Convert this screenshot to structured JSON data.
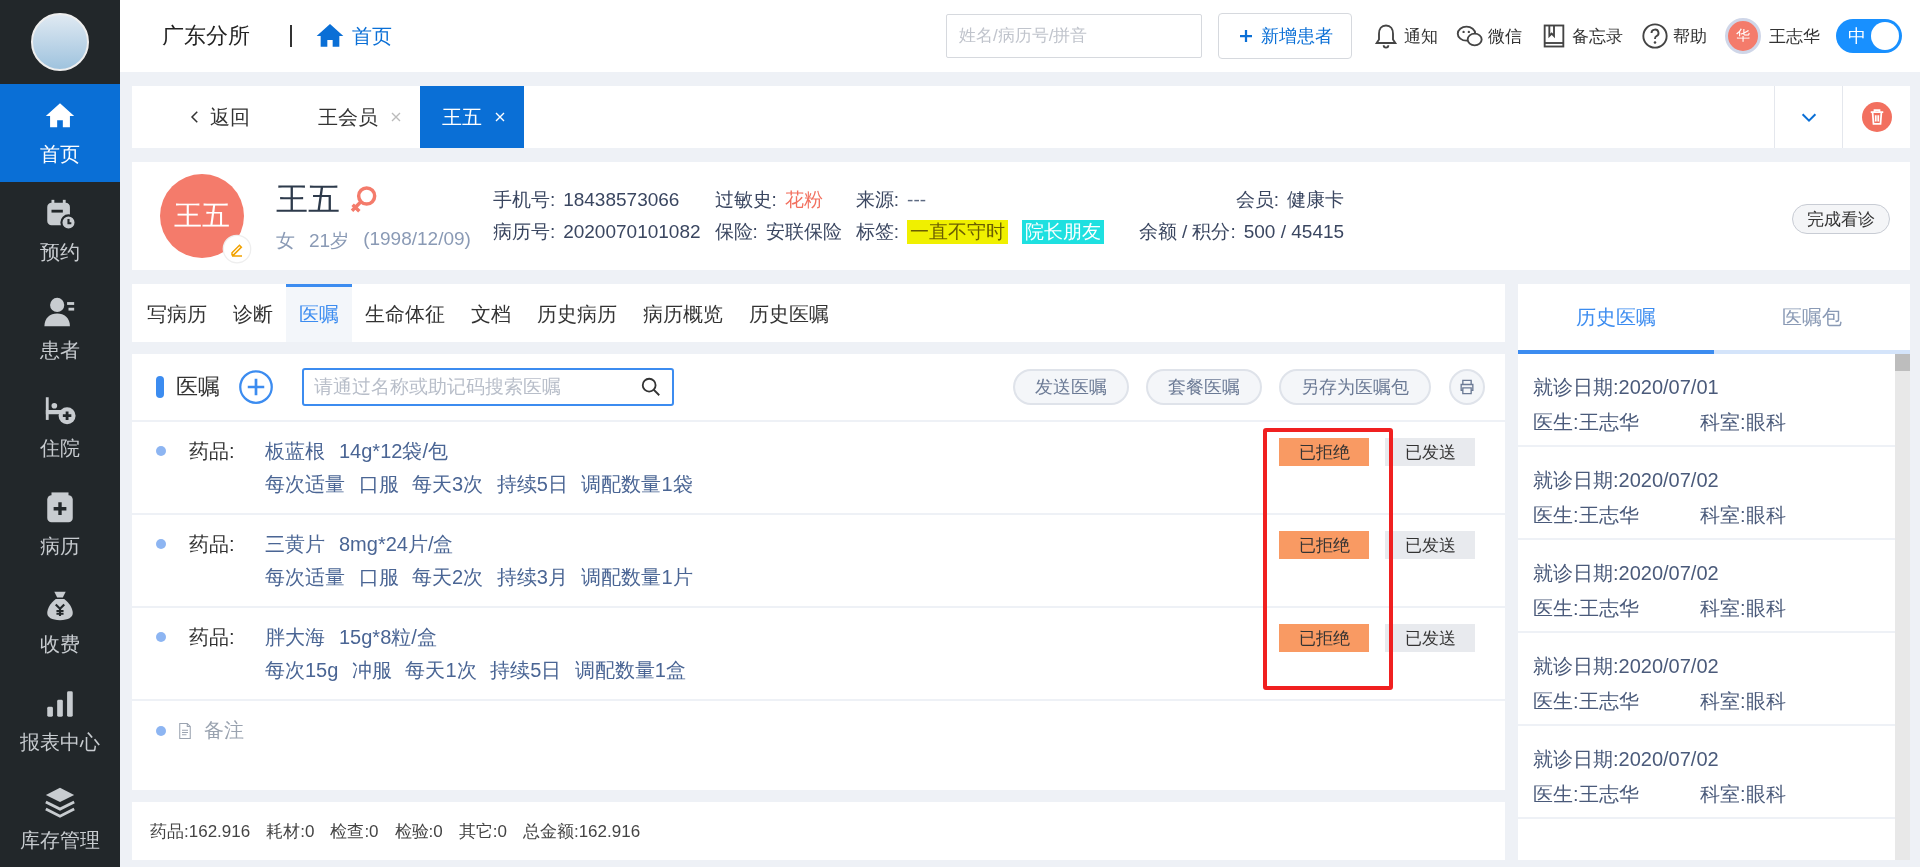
{
  "sidebar": {
    "items": [
      {
        "label": "首页",
        "kind": "home",
        "selected": true
      },
      {
        "label": "预约",
        "kind": "calendar",
        "selected": false
      },
      {
        "label": "患者",
        "kind": "person",
        "selected": false
      },
      {
        "label": "住院",
        "kind": "bed",
        "selected": false
      },
      {
        "label": "病历",
        "kind": "record",
        "selected": false
      },
      {
        "label": "收费",
        "kind": "moneybag",
        "selected": false
      },
      {
        "label": "报表中心",
        "kind": "bars",
        "selected": false
      },
      {
        "label": "库存管理",
        "kind": "layers",
        "selected": false
      }
    ]
  },
  "topbar": {
    "clinic": "广东分所",
    "breadcrumb": "首页",
    "search": {
      "placeholder": "姓名/病历号/拼音"
    },
    "add_button": "新增患者",
    "actions": [
      {
        "kind": "bell",
        "label": "通知"
      },
      {
        "kind": "chat",
        "label": "微信"
      },
      {
        "kind": "book",
        "label": "备忘录"
      },
      {
        "kind": "help",
        "label": "帮助"
      }
    ],
    "user": {
      "avatar_text": "华",
      "name": "王志华"
    },
    "toggle": {
      "label": "中",
      "on": true
    }
  },
  "open_tabs": {
    "back": "返回",
    "tabs": [
      {
        "label": "王会员",
        "selected": false
      },
      {
        "label": "王五",
        "selected": true
      }
    ]
  },
  "patient": {
    "avatar_text": "王五",
    "name": "王五",
    "sex": "女",
    "age": "21岁",
    "birth": "(1998/12/09)",
    "fields": [
      {
        "label": "手机号:",
        "value": "18438573066"
      },
      {
        "label": "过敏史:",
        "value": "花粉",
        "kind": "alert"
      },
      {
        "label": "来源:",
        "value": "---",
        "kind": "muted"
      },
      {
        "label": "会员:",
        "value": "健康卡"
      },
      {
        "label": "病历号:",
        "value": "2020070101082"
      },
      {
        "label": "保险:",
        "value": "安联保险"
      },
      {
        "label": "余额 / 积分:",
        "value": "500 / 45415"
      }
    ],
    "tags": {
      "label": "标签:",
      "items": [
        {
          "text": "一直不守时",
          "color": "#f0f000"
        },
        {
          "text": "院长朋友",
          "color": "#1ee0e0"
        }
      ]
    },
    "finish_button": "完成看诊"
  },
  "record_tabs": [
    {
      "label": "写病历",
      "selected": false
    },
    {
      "label": "诊断",
      "selected": false
    },
    {
      "label": "医嘱",
      "selected": true
    },
    {
      "label": "生命体征",
      "selected": false
    },
    {
      "label": "文档",
      "selected": false
    },
    {
      "label": "历史病历",
      "selected": false
    },
    {
      "label": "病历概览",
      "selected": false
    },
    {
      "label": "历史医嘱",
      "selected": false
    }
  ],
  "orders": {
    "title": "医嘱",
    "search": {
      "placeholder": "请通过名称或助记码搜索医嘱"
    },
    "buttons": [
      "发送医嘱",
      "套餐医嘱",
      "另存为医嘱包"
    ],
    "items": [
      {
        "type_label": "药品:",
        "name": "板蓝根",
        "spec": "14g*12袋/包",
        "usage": "每次适量 口服 每天3次 持续5日 调配数量1袋",
        "statuses": [
          {
            "label": "已拒绝",
            "kind": "rejected"
          },
          {
            "label": "已发送",
            "kind": "sent"
          }
        ]
      },
      {
        "type_label": "药品:",
        "name": "三黄片",
        "spec": "8mg*24片/盒",
        "usage": "每次适量 口服 每天2次 持续3月 调配数量1片",
        "statuses": [
          {
            "label": "已拒绝",
            "kind": "rejected"
          },
          {
            "label": "已发送",
            "kind": "sent"
          }
        ]
      },
      {
        "type_label": "药品:",
        "name": "胖大海",
        "spec": "15g*8粒/盒",
        "usage": "每次15g 冲服 每天1次 持续5日 调配数量1盒",
        "statuses": [
          {
            "label": "已拒绝",
            "kind": "rejected"
          },
          {
            "label": "已发送",
            "kind": "sent"
          }
        ]
      }
    ],
    "note": "备注"
  },
  "totals": [
    "药品:162.916",
    "耗材:0",
    "检查:0",
    "检验:0",
    "其它:0",
    "总金额:162.916"
  ],
  "history": {
    "tabs": [
      {
        "label": "历史医嘱",
        "selected": true
      },
      {
        "label": "医嘱包",
        "selected": false
      }
    ],
    "entries": [
      {
        "date": "就诊日期:2020/07/01",
        "doctor": "医生:王志华",
        "dept": "科室:眼科"
      },
      {
        "date": "就诊日期:2020/07/02",
        "doctor": "医生:王志华",
        "dept": "科室:眼科"
      },
      {
        "date": "就诊日期:2020/07/02",
        "doctor": "医生:王志华",
        "dept": "科室:眼科"
      },
      {
        "date": "就诊日期:2020/07/02",
        "doctor": "医生:王志华",
        "dept": "科室:眼科"
      },
      {
        "date": "就诊日期:2020/07/02",
        "doctor": "医生:王志华",
        "dept": "科室:眼科"
      }
    ]
  }
}
